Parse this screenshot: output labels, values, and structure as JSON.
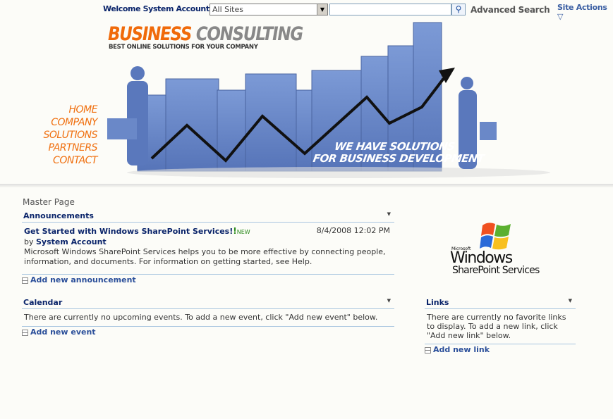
{
  "topbar": {
    "welcome": "Welcome System Account",
    "welcome_arrow": "▼",
    "scope": "All Sites",
    "search_value": "",
    "search_icon": "magnifier-icon",
    "advanced_search": "Advanced Search",
    "site_actions": "Site Actions",
    "site_actions_arrow": "▽"
  },
  "banner": {
    "title_orange": "BUSINESS",
    "title_gray": "CONSULTING",
    "tagline": "BEST ONLINE SOLUTIONS FOR YOUR COMPANY",
    "nav": [
      "HOME",
      "COMPANY",
      "SOLUTIONS",
      "PARTNERS",
      "CONTACT"
    ],
    "slogan1": "WE HAVE SOLUTIONS",
    "slogan2": "FOR BUSINESS DEVELOPMENT"
  },
  "page_title": "Master Page",
  "announcements": {
    "title": "Announcements",
    "item_title": "Get Started with Windows SharePoint Services!",
    "new_badge": "NEW",
    "date": "8/4/2008 12:02 PM",
    "by": "by",
    "author": "System Account",
    "body": "Microsoft Windows SharePoint Services helps you to be more effective by connecting people, information, and documents. For information on getting started, see Help.",
    "add": "Add new announcement"
  },
  "calendar": {
    "title": "Calendar",
    "empty": "There are currently no upcoming events. To add a new event, click \"Add new event\" below.",
    "add": "Add new event"
  },
  "links": {
    "title": "Links",
    "empty": "There are currently no favorite links to display. To add a new link, click \"Add new link\" below.",
    "add": "Add new link"
  },
  "wss_logo": {
    "microsoft": "Microsoft",
    "windows": "Windows",
    "sps": "SharePoint Services"
  }
}
